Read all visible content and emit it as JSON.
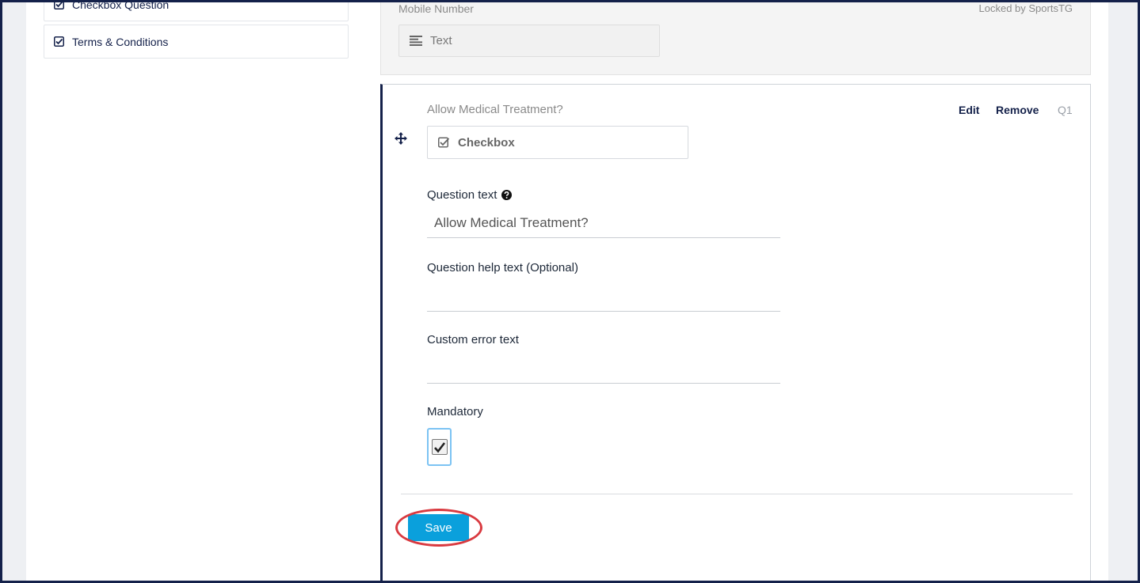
{
  "sidebar": {
    "items": [
      {
        "label": "Checkbox Question",
        "icon": "checkbox-icon"
      },
      {
        "label": "Terms & Conditions",
        "icon": "checkbox-icon"
      }
    ]
  },
  "locked_field": {
    "label": "Mobile Number",
    "locked_by": "Locked by SportsTG",
    "type_label": "Text",
    "type_icon": "text-lines-icon"
  },
  "question": {
    "title": "Allow Medical Treatment?",
    "edit_label": "Edit",
    "remove_label": "Remove",
    "number": "Q1",
    "type_label": "Checkbox",
    "type_icon": "checkbox-icon",
    "question_text_label": "Question text",
    "question_text_value": "Allow Medical Treatment?",
    "help_text_label": "Question help text (Optional)",
    "help_text_value": "",
    "error_text_label": "Custom error text",
    "error_text_value": "",
    "mandatory_label": "Mandatory",
    "mandatory_checked": true,
    "save_label": "Save"
  },
  "colors": {
    "navy": "#14214a",
    "save_button": "#0aa0dc",
    "highlight": "#d93a40",
    "focus_ring": "#7cc3f3"
  }
}
